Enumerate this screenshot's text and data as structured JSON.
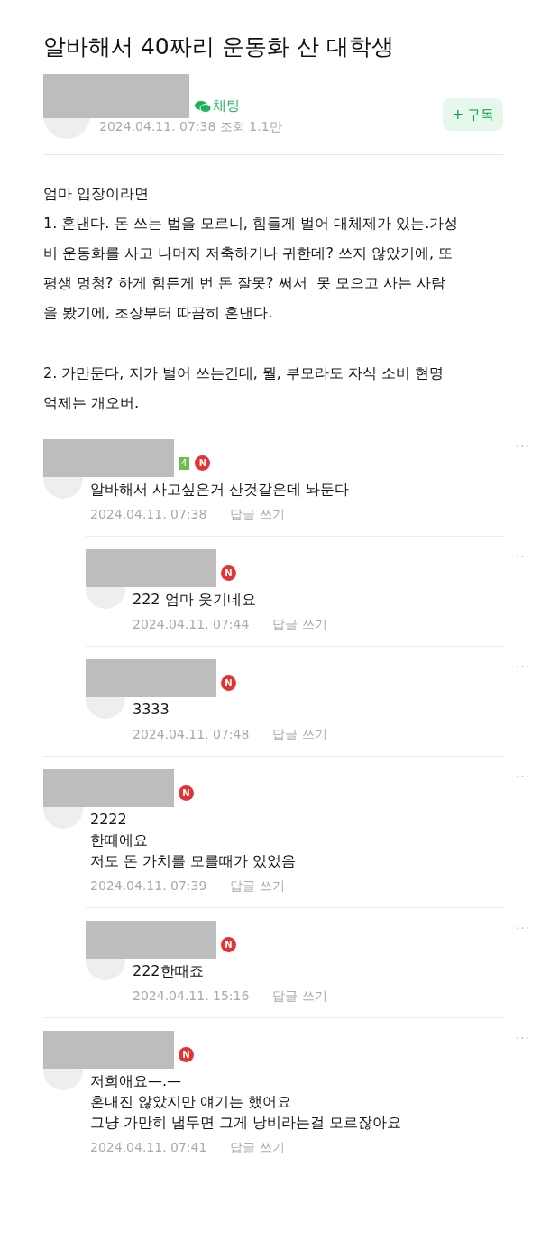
{
  "title": "알바해서 40짜리 운동화 산 대학생",
  "author": {
    "chat_label": "채팅",
    "date": "2024.04.11. 07:38",
    "views": "조회 1.1만",
    "subscribe": {
      "icon": "+",
      "label": "구독"
    }
  },
  "body": [
    "엄마 입장이라면\n1. 혼낸다. 돈 쓰는 법을 모르니, 힘들게 벌어 대체제가 있는.가성\n비 운동화를 사고 나머지 저축하거나 귀한데? 쓰지 않았기에, 또\n평생 멍청? 하게 힘든게 번 돈 잘못? 써서  못 모으고 사는 사람\n을 봤기에, 초장부터 따끔히 혼낸다.",
    "2. 가만둔다, 지가 벌어 쓰는건데, 뭘, 부모라도 자식 소비 현명\n억제는 개오버."
  ],
  "comments": [
    {
      "level_badge": "4",
      "new_badge": "N",
      "text": "알바해서 사고싶은거 산것같은데 놔둔다",
      "date": "2024.04.11. 07:38",
      "reply": "답글 쓰기",
      "more": "···",
      "children": [
        {
          "new_badge": "N",
          "text": "222 엄마 웃기네요",
          "date": "2024.04.11. 07:44",
          "reply": "답글 쓰기",
          "more": "···"
        },
        {
          "new_badge": "N",
          "text": "3333",
          "date": "2024.04.11. 07:48",
          "reply": "답글 쓰기",
          "more": "···"
        }
      ]
    },
    {
      "new_badge": "N",
      "text": "2222\n한때에요\n저도 돈 가치를 모를때가 있었음",
      "date": "2024.04.11. 07:39",
      "reply": "답글 쓰기",
      "more": "···",
      "children": [
        {
          "new_badge": "N",
          "text": "222한때죠",
          "date": "2024.04.11. 15:16",
          "reply": "답글 쓰기",
          "more": "···"
        }
      ]
    },
    {
      "new_badge": "N",
      "text": "저희애요—.—\n혼내진 않았지만 얘기는 했어요\n그냥 가만히 냅두면 그게 낭비라는걸 모르잖아요",
      "date": "2024.04.11. 07:41",
      "reply": "답글 쓰기",
      "more": "···"
    }
  ]
}
